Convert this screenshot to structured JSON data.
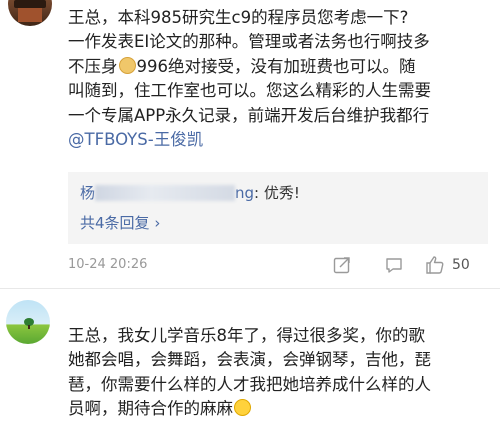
{
  "comment1": {
    "avatar_icon": "castle-avatar-icon",
    "lines": [
      "王总，本科985研究生c9的程序员您考虑一下?",
      "一作发表EI论文的那种。管理或者法务也行啊技多",
      "不压身"
    ],
    "line3_rest": "996绝对接受，没有加班费也可以。随",
    "lines_more": [
      "叫随到，住工作室也可以。您这么精彩的人生需要",
      "一个专属APP永久记录，前端开发后台维护我都行"
    ],
    "mention": "@TFBOYS-王俊凯",
    "emoji": "doge-emoji-icon",
    "reply": {
      "author_prefix": "杨",
      "author_suffix": "ng",
      "text": ": 优秀!",
      "count_label": "共4条回复",
      "chevron": "›"
    },
    "timestamp": "10-24 20:26",
    "actions": {
      "share_icon": "share-icon",
      "comment_icon": "comment-icon",
      "like_icon": "thumbs-up-icon",
      "like_count": "50"
    }
  },
  "comment2": {
    "avatar_icon": "tree-landscape-avatar-icon",
    "lines": [
      "王总，我女儿学音乐8年了，得过很多奖，你的歌",
      "她都会唱，会舞蹈，会表演，会弹钢琴，吉他，琵",
      "琶，你需要什么样的人才我把她培养成什么样的人"
    ],
    "last_line": "员啊，期待合作的麻麻",
    "emoji": "laughing-tears-emoji-icon"
  },
  "colors": {
    "link": "#4a6aa5",
    "reply_bg": "#f4f4f4",
    "meta": "#999999"
  }
}
